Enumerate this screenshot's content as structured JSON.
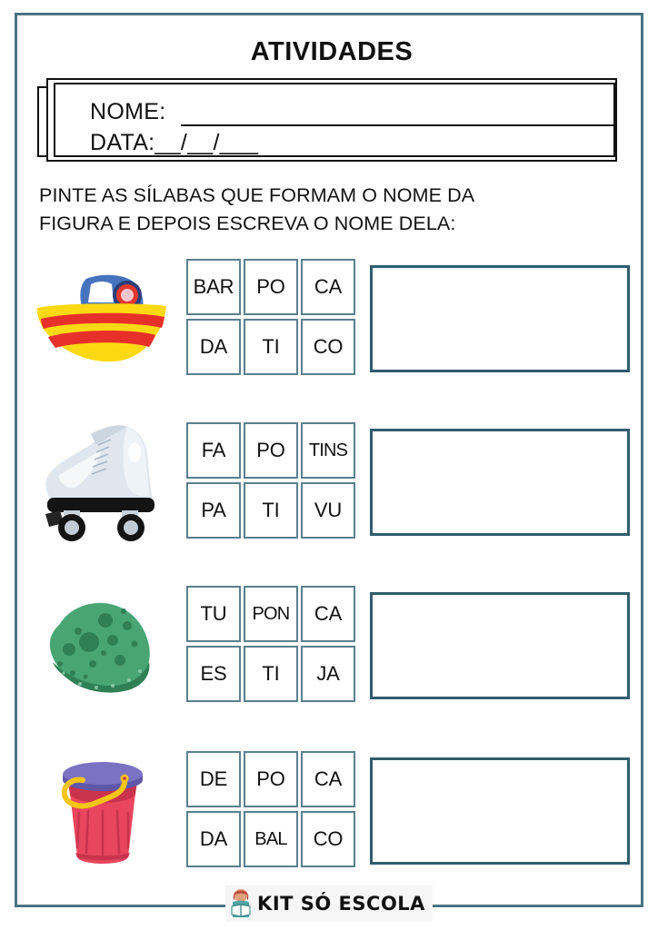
{
  "page": {
    "title": "ATIVIDADES",
    "border_color": "#4a7383"
  },
  "id_fields": {
    "name_label": "NOME:",
    "date_label": "DATA:__/__/___"
  },
  "instructions": {
    "line1": "PINTE AS SÍLABAS QUE FORMAM O NOME DA",
    "line2": "FIGURA E DEPOIS ESCREVA O NOME DELA:"
  },
  "exercises": [
    {
      "picture": "boat-illustration",
      "picture_label": "BARCO",
      "syllables": [
        "BAR",
        "PO",
        "CA",
        "DA",
        "TI",
        "CO"
      ],
      "answer": ""
    },
    {
      "picture": "roller-skate-illustration",
      "picture_label": "PATINS",
      "syllables": [
        "FA",
        "PO",
        "TINS",
        "PA",
        "TI",
        "VU"
      ],
      "answer": ""
    },
    {
      "picture": "sponge-illustration",
      "picture_label": "ESPONJA",
      "syllables": [
        "TU",
        "PON",
        "CA",
        "ES",
        "TI",
        "JA"
      ],
      "answer": ""
    },
    {
      "picture": "bucket-illustration",
      "picture_label": "BALDE",
      "syllables": [
        "DE",
        "PO",
        "CA",
        "DA",
        "BAL",
        "CO"
      ],
      "answer": ""
    }
  ],
  "footer": {
    "brand": "KIT SÓ ESCOLA"
  },
  "colors": {
    "page_border": "#4a7383",
    "syllable_border": "#5a7f8c",
    "answer_border": "#2f5d6e",
    "text": "#111111"
  }
}
